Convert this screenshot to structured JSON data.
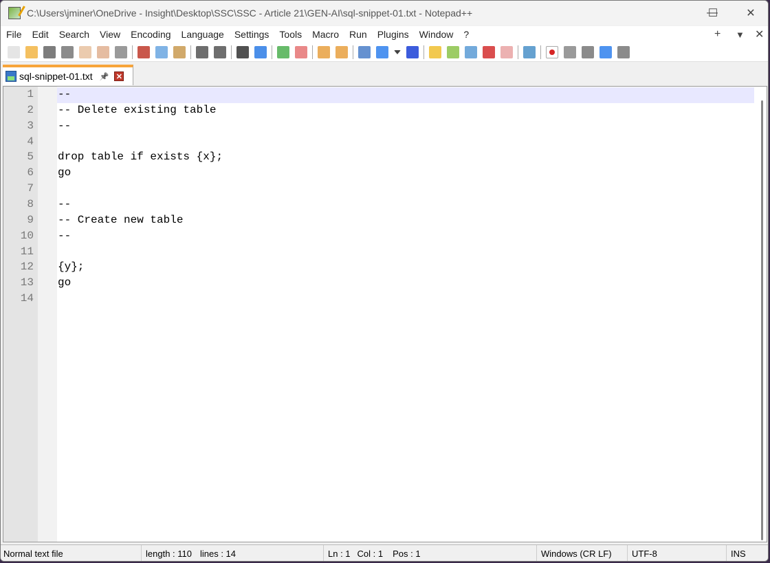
{
  "window": {
    "title": "C:\\Users\\jminer\\OneDrive - Insight\\Desktop\\SSC\\SSC - Article 21\\GEN-AI\\sql-snippet-01.txt - Notepad++",
    "minimize": "—",
    "maximize": "☐",
    "close": "✕"
  },
  "menu": [
    "File",
    "Edit",
    "Search",
    "View",
    "Encoding",
    "Language",
    "Settings",
    "Tools",
    "Macro",
    "Run",
    "Plugins",
    "Window",
    "?"
  ],
  "menu_right": {
    "add": "+",
    "list": "▼",
    "close": "✕"
  },
  "toolbar": [
    {
      "name": "new-file-icon",
      "color": "#e0e0e0"
    },
    {
      "name": "open-file-icon",
      "color": "#f2b544"
    },
    {
      "name": "save-icon",
      "color": "#666666"
    },
    {
      "name": "save-all-icon",
      "color": "#777777"
    },
    {
      "name": "close-file-icon",
      "color": "#e8c2a0"
    },
    {
      "name": "close-all-icon",
      "color": "#e0b090"
    },
    {
      "name": "print-icon",
      "color": "#888888"
    },
    "sep",
    {
      "name": "cut-icon",
      "color": "#c0392b"
    },
    {
      "name": "copy-icon",
      "color": "#6aa6e0"
    },
    {
      "name": "paste-icon",
      "color": "#c99a50"
    },
    "sep",
    {
      "name": "undo-icon",
      "color": "#555555"
    },
    {
      "name": "redo-icon",
      "color": "#555555"
    },
    "sep",
    {
      "name": "find-icon",
      "color": "#333333"
    },
    {
      "name": "replace-icon",
      "color": "#2c7be5"
    },
    "sep",
    {
      "name": "zoom-in-icon",
      "color": "#4caf50"
    },
    {
      "name": "zoom-out-icon",
      "color": "#e57373"
    },
    "sep",
    {
      "name": "sync-vertical-icon",
      "color": "#e8a040"
    },
    {
      "name": "sync-horizontal-icon",
      "color": "#e8a040"
    },
    "sep",
    {
      "name": "word-wrap-icon",
      "color": "#4a7ec8"
    },
    {
      "name": "show-all-chars-icon",
      "color": "#2f80ed"
    },
    {
      "name": "dropdown-arrow-icon",
      "color": "#222222"
    },
    {
      "name": "indent-guide-icon",
      "color": "#1a3fd6"
    },
    "sep",
    {
      "name": "user-language-icon",
      "color": "#f0c030"
    },
    {
      "name": "document-map-icon",
      "color": "#8bc34a"
    },
    {
      "name": "document-list-icon",
      "color": "#5b9bd5"
    },
    {
      "name": "function-list-icon",
      "color": "#d32f2f"
    },
    {
      "name": "folder-workspace-icon",
      "color": "#e9a3a3"
    },
    "sep",
    {
      "name": "monitoring-icon",
      "color": "#4a90c8"
    },
    "sep",
    {
      "name": "record-macro-icon",
      "color": "#d00000"
    },
    {
      "name": "stop-macro-icon",
      "color": "#888888"
    },
    {
      "name": "play-macro-icon",
      "color": "#777777"
    },
    {
      "name": "run-macro-multiple-icon",
      "color": "#2f80ed"
    },
    {
      "name": "save-macro-icon",
      "color": "#777777"
    }
  ],
  "tab": {
    "label": "sql-snippet-01.txt",
    "pin": "📌",
    "close": "✕"
  },
  "editor": {
    "lines": [
      "--",
      "-- Delete existing table",
      "--",
      "",
      "drop table if exists {x};",
      "go",
      "",
      "--",
      "-- Create new table",
      "--",
      "",
      "{y};",
      "go",
      ""
    ]
  },
  "status": {
    "type": "Normal text file",
    "length": "length : 110",
    "lines": "lines : 14",
    "ln": "Ln : 1",
    "col": "Col : 1",
    "pos": "Pos : 1",
    "eol": "Windows (CR LF)",
    "encoding": "UTF-8",
    "mode": "INS"
  }
}
